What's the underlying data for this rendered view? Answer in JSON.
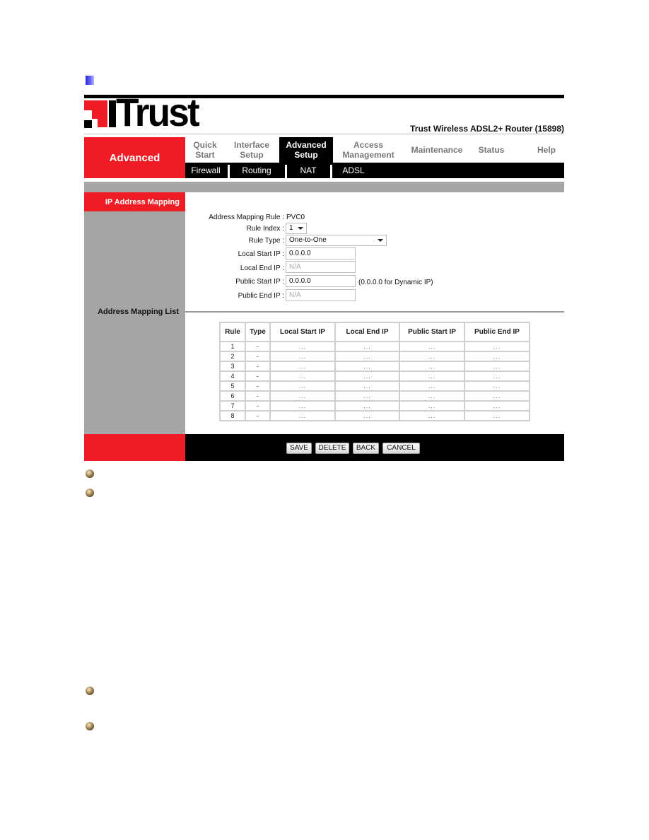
{
  "header": {
    "logo_text": "Trust",
    "product_title": "Trust Wireless ADSL2+ Router (15898)"
  },
  "nav": {
    "section_label": "Advanced",
    "main_tabs": [
      {
        "line1": "Quick",
        "line2": "Start",
        "active": false
      },
      {
        "line1": "Interface",
        "line2": "Setup",
        "active": false
      },
      {
        "line1": "Advanced",
        "line2": "Setup",
        "active": true
      },
      {
        "line1": "Access",
        "line2": "Management",
        "active": false
      },
      {
        "line1": "Maintenance",
        "line2": "",
        "active": false
      },
      {
        "line1": "Status",
        "line2": "",
        "active": false
      },
      {
        "line1": "Help",
        "line2": "",
        "active": false
      }
    ],
    "sub_tabs": [
      "Firewall",
      "Routing",
      "NAT",
      "ADSL"
    ]
  },
  "sidebar": {
    "active_item": "IP Address Mapping",
    "list_label": "Address Mapping List"
  },
  "form": {
    "mapping_rule_label": "Address Mapping Rule :",
    "mapping_rule_value": "PVC0",
    "rule_index_label": "Rule Index :",
    "rule_index_value": "1",
    "rule_type_label": "Rule Type :",
    "rule_type_value": "One-to-One",
    "local_start_label": "Local Start IP :",
    "local_start_value": "0.0.0.0",
    "local_end_label": "Local End IP :",
    "local_end_value": "N/A",
    "public_start_label": "Public Start IP :",
    "public_start_value": "0.0.0.0",
    "public_start_hint": "(0.0.0.0 for Dynamic IP)",
    "public_end_label": "Public End IP :",
    "public_end_value": "N/A"
  },
  "table": {
    "headers": [
      "Rule",
      "Type",
      "Local Start IP",
      "Local End IP",
      "Public Start IP",
      "Public End IP"
    ],
    "rows": [
      [
        "1",
        "-",
        "...",
        "...",
        "...",
        "..."
      ],
      [
        "2",
        "-",
        "...",
        "...",
        "...",
        "..."
      ],
      [
        "3",
        "-",
        "...",
        "...",
        "...",
        "..."
      ],
      [
        "4",
        "-",
        "...",
        "...",
        "...",
        "..."
      ],
      [
        "5",
        "-",
        "...",
        "...",
        "...",
        "..."
      ],
      [
        "6",
        "-",
        "...",
        "...",
        "...",
        "..."
      ],
      [
        "7",
        "-",
        "...",
        "...",
        "...",
        "..."
      ],
      [
        "8",
        "-",
        "...",
        "...",
        "...",
        "..."
      ]
    ]
  },
  "buttons": {
    "save": "SAVE",
    "delete": "DELETE",
    "back": "BACK",
    "cancel": "CANCEL"
  },
  "colors": {
    "brand_red": "#ee1c25",
    "bar_black": "#000000",
    "panel_gray": "#a5a5a5"
  }
}
